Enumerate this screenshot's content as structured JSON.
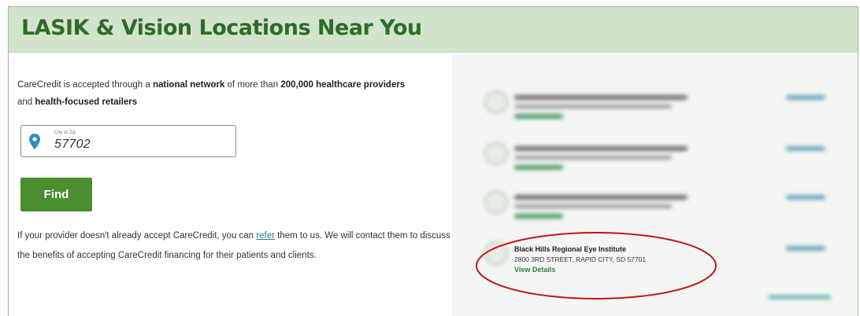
{
  "header": {
    "title": "LASIK & Vision Locations Near You"
  },
  "intro": {
    "t1": "CareCredit is accepted through a ",
    "b1": "national network",
    "t2": " of more than ",
    "b2": "200,000 healthcare providers",
    "t3": " and ",
    "b3": "health-focused retailers"
  },
  "search": {
    "label": "City or Zip",
    "value": "57702"
  },
  "find_button": {
    "label": "Find"
  },
  "footer": {
    "t1": "If your provider doesn't already accept CareCredit, you can ",
    "link": "refer",
    "t2": " them to us. We will contact them to discuss the benefits of accepting CareCredit financing for their patients and clients."
  },
  "results": [
    {
      "blurred": true
    },
    {
      "blurred": true
    },
    {
      "blurred": true
    },
    {
      "blurred": false,
      "name": "Black Hills Regional Eye Institute",
      "address": "2800 3RD STREET, RAPID CITY, SD 57701",
      "link": "View Details"
    }
  ],
  "colors": {
    "header_bg": "#d3e3cc",
    "title_green": "#2f6b2a",
    "button_green": "#4a8e2f",
    "link_teal": "#2a7d8d",
    "highlight_red": "#c0141b",
    "pin_blue": "#2b8fc4"
  },
  "icons": {
    "search_field": "map-pin-icon",
    "result_marker": "circle-icon",
    "distance": "map-pin-icon"
  }
}
